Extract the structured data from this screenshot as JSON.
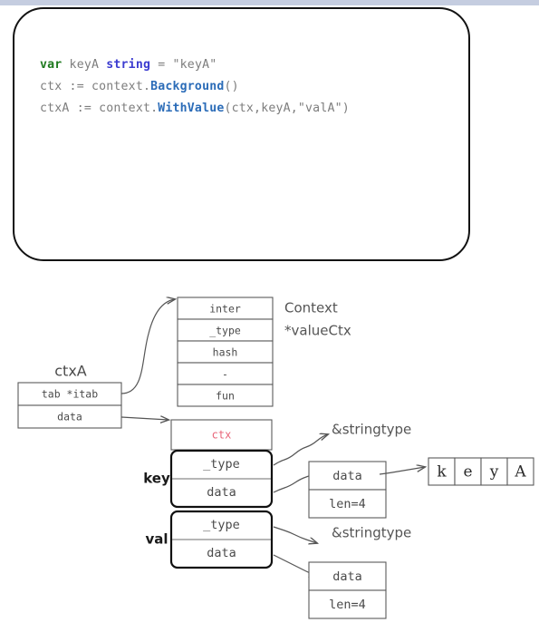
{
  "page": {
    "topbar_color": "#c5cde0",
    "background": "#ffffff"
  },
  "code_card": {
    "lines": [
      {
        "tokens": [
          {
            "text": "var",
            "kind": "keyword"
          },
          {
            "text": " keyA ",
            "kind": "plain"
          },
          {
            "text": "string",
            "kind": "type"
          },
          {
            "text": " = \"keyA\"",
            "kind": "plain"
          }
        ]
      },
      {
        "tokens": [
          {
            "text": "ctx := context.",
            "kind": "plain"
          },
          {
            "text": "Background",
            "kind": "func"
          },
          {
            "text": "()",
            "kind": "plain"
          }
        ]
      },
      {
        "tokens": [
          {
            "text": "ctxA := context.",
            "kind": "plain"
          },
          {
            "text": "WithValue",
            "kind": "func"
          },
          {
            "text": "(ctx,keyA,\"valA\")",
            "kind": "plain"
          }
        ]
      }
    ],
    "colors": {
      "keyword": "#1f7a1f",
      "type": "#3b3bd0",
      "func": "#2b6cb8",
      "plain": "#7d7d7d",
      "border": "#121212"
    }
  },
  "diagram": {
    "itab_table": {
      "rows": [
        "inter",
        "_type",
        "hash",
        "-",
        "fun"
      ]
    },
    "itab_labels": {
      "line1": "Context",
      "line2": "*valueCtx"
    },
    "ctxA_iface": {
      "title": "ctxA",
      "rows": [
        "tab *itab",
        "data"
      ]
    },
    "valuectx": {
      "header": "ctx",
      "key_label": "key",
      "val_label": "val",
      "key_rows": [
        "_type",
        "data"
      ],
      "val_rows": [
        "_type",
        "data"
      ]
    },
    "key_type_target": "&stringtype",
    "val_type_target": "&stringtype",
    "key_string_header": {
      "rows": [
        "data",
        "len=4"
      ]
    },
    "val_string_header": {
      "rows": [
        "data",
        "len=4"
      ]
    },
    "string_bytes": [
      "k",
      "e",
      "y",
      "A"
    ]
  }
}
